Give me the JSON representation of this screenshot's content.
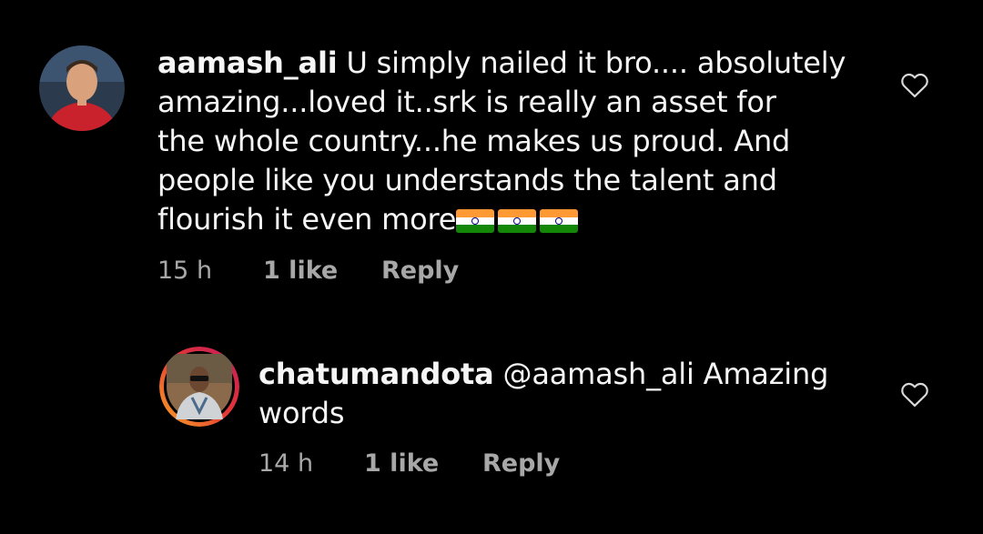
{
  "comments": [
    {
      "username": "aamash_ali",
      "text_lines": [
        "U simply nailed it bro.... absolutely",
        "amazing...loved it..srk is really an asset for",
        "the whole country...he makes us proud. And",
        "people like you understands the talent and",
        "flourish it even more"
      ],
      "emoji": [
        "india-flag",
        "india-flag",
        "india-flag"
      ],
      "time": "15 h",
      "likes": "1 like",
      "reply_label": "Reply"
    },
    {
      "username": "chatumandota",
      "text_lines": [
        "@aamash_ali Amazing",
        "words"
      ],
      "time": "14 h",
      "likes": "1 like",
      "reply_label": "Reply"
    }
  ],
  "colors": {
    "background": "#000000",
    "text": "#f5f5f5",
    "meta": "#a8a8a8",
    "story_ring_start": "#f9a825",
    "story_ring_end": "#c2185b"
  },
  "icons": {
    "like": "heart-outline-icon"
  }
}
